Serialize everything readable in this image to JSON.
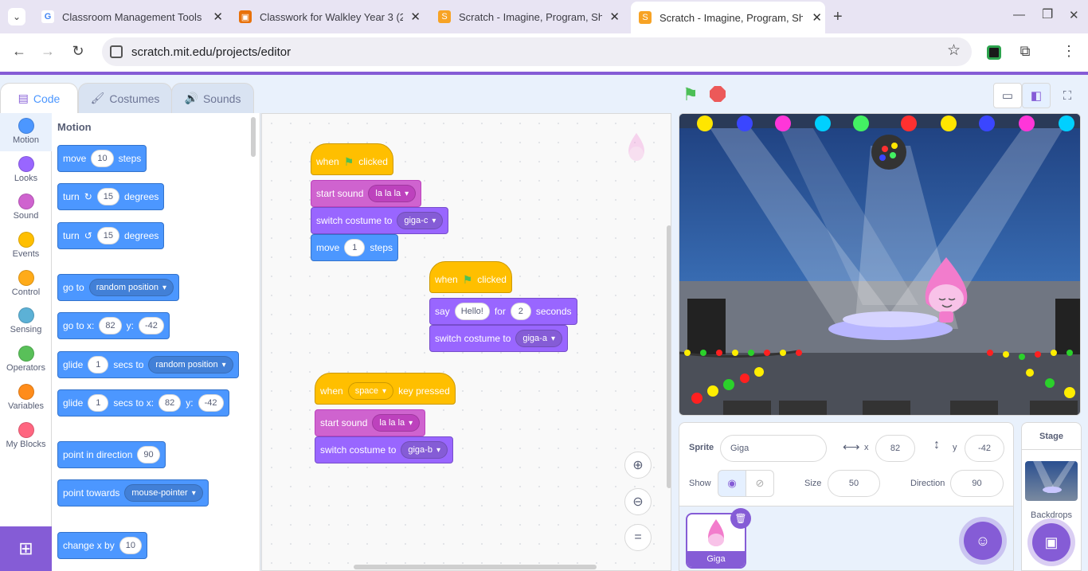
{
  "browser": {
    "tabs": [
      {
        "title": "Classroom Management Tools",
        "favicon": "G"
      },
      {
        "title": "Classwork for Walkley Year 3 (2",
        "favicon": "▣"
      },
      {
        "title": "Scratch - Imagine, Program, Sha",
        "favicon": "S"
      },
      {
        "title": "Scratch - Imagine, Program, Sha",
        "favicon": "S"
      }
    ],
    "new_tab": "+",
    "url": "scratch.mit.edu/projects/editor",
    "window_controls": [
      "—",
      "❐",
      "✕"
    ]
  },
  "editor": {
    "tabs": {
      "code": "Code",
      "costumes": "Costumes",
      "sounds": "Sounds"
    },
    "categories": [
      {
        "label": "Motion",
        "color": "#4c97ff"
      },
      {
        "label": "Looks",
        "color": "#9966ff"
      },
      {
        "label": "Sound",
        "color": "#cf63cf"
      },
      {
        "label": "Events",
        "color": "#ffbf00"
      },
      {
        "label": "Control",
        "color": "#ffab19"
      },
      {
        "label": "Sensing",
        "color": "#5cb1d6"
      },
      {
        "label": "Operators",
        "color": "#59c059"
      },
      {
        "label": "Variables",
        "color": "#ff8c1a"
      },
      {
        "label": "My Blocks",
        "color": "#ff6680"
      }
    ],
    "palette": {
      "title": "Motion",
      "move": {
        "a": "move",
        "v": "10",
        "b": "steps"
      },
      "turn_cw": {
        "a": "turn",
        "v": "15",
        "b": "degrees"
      },
      "turn_ccw": {
        "a": "turn",
        "v": "15",
        "b": "degrees"
      },
      "goto": {
        "a": "go to",
        "dd": "random position"
      },
      "gotoxy": {
        "a": "go to x:",
        "x": "82",
        "b": "y:",
        "y": "-42"
      },
      "glide": {
        "a": "glide",
        "v": "1",
        "b": "secs to",
        "dd": "random position"
      },
      "glidexy": {
        "a": "glide",
        "v": "1",
        "b": "secs to x:",
        "x": "82",
        "c": "y:",
        "y": "-42"
      },
      "point": {
        "a": "point in direction",
        "v": "90"
      },
      "towards": {
        "a": "point towards",
        "dd": "mouse-pointer"
      },
      "changex": {
        "a": "change x by",
        "v": "10"
      }
    },
    "scripts": {
      "s1": {
        "hat_a": "when",
        "hat_b": "clicked",
        "sound_a": "start sound",
        "sound_dd": "la la la",
        "costume_a": "switch costume to",
        "costume_dd": "giga-c",
        "move_a": "move",
        "move_v": "1",
        "move_b": "steps"
      },
      "s2": {
        "hat_a": "when",
        "hat_b": "clicked",
        "say_a": "say",
        "say_v": "Hello!",
        "say_b": "for",
        "say_n": "2",
        "say_c": "seconds",
        "costume_a": "switch costume to",
        "costume_dd": "giga-a"
      },
      "s3": {
        "hat_a": "when",
        "hat_dd": "space",
        "hat_b": "key pressed",
        "sound_a": "start sound",
        "sound_dd": "la la la",
        "costume_a": "switch costume to",
        "costume_dd": "giga-b"
      }
    }
  },
  "sprite_info": {
    "sprite_label": "Sprite",
    "sprite_name": "Giga",
    "x_label": "x",
    "x": "82",
    "y_label": "y",
    "y": "-42",
    "show_label": "Show",
    "size_label": "Size",
    "size": "50",
    "direction_label": "Direction",
    "direction": "90"
  },
  "sprites": [
    {
      "name": "Giga"
    }
  ],
  "stage_panel": {
    "title": "Stage",
    "backdrops": "Backdrops"
  }
}
